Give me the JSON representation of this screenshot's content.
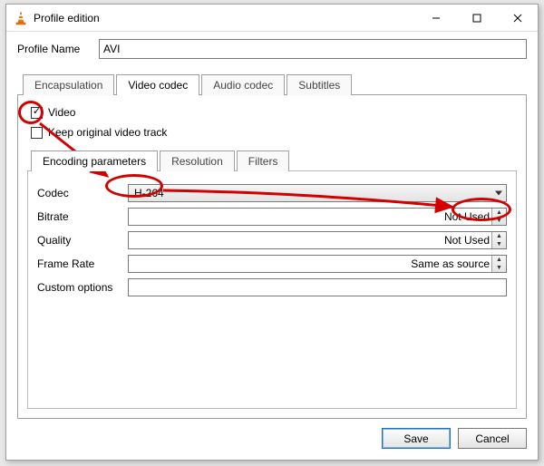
{
  "window": {
    "title": "Profile edition"
  },
  "form": {
    "profile_name_label": "Profile Name",
    "profile_name_value": "AVI"
  },
  "outer_tabs": {
    "encapsulation": "Encapsulation",
    "video_codec": "Video codec",
    "audio_codec": "Audio codec",
    "subtitles": "Subtitles"
  },
  "video_tab": {
    "video_checkbox_label": "Video",
    "video_checked": true,
    "keep_original_label": "Keep original video track",
    "keep_original_checked": false
  },
  "inner_tabs": {
    "encoding": "Encoding parameters",
    "resolution": "Resolution",
    "filters": "Filters"
  },
  "encoding": {
    "codec_label": "Codec",
    "codec_value": "H-264",
    "bitrate_label": "Bitrate",
    "bitrate_value": "Not Used",
    "quality_label": "Quality",
    "quality_value": "Not Used",
    "framerate_label": "Frame Rate",
    "framerate_value": "Same as source",
    "custom_label": "Custom options",
    "custom_value": ""
  },
  "buttons": {
    "save": "Save",
    "cancel": "Cancel"
  }
}
